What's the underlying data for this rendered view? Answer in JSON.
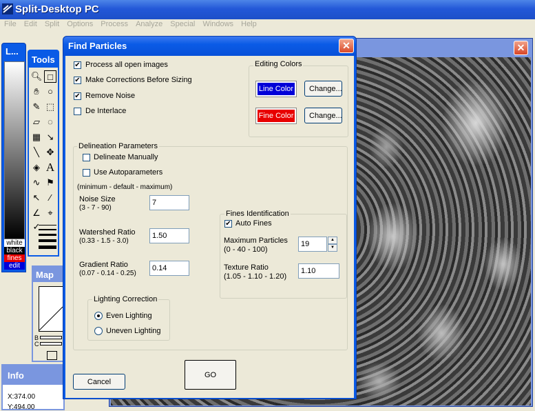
{
  "app": {
    "title": "Split-Desktop PC",
    "menu": [
      "File",
      "Edit",
      "Split",
      "Options",
      "Process",
      "Analyze",
      "Special",
      "Windows",
      "Help"
    ]
  },
  "lut_window": {
    "title": "L...",
    "labels": [
      "white",
      "black",
      "fines",
      "edit"
    ]
  },
  "tools_window": {
    "title": "Tools",
    "text_tool_glyph": "A"
  },
  "map_window": {
    "title": "Map",
    "labels": [
      "B",
      "C"
    ]
  },
  "info_window": {
    "title": "Info",
    "x": "X:374.00",
    "y": "Y:494.00"
  },
  "image_window": {
    "close_glyph": "✕"
  },
  "dialog": {
    "title": "Find Particles",
    "close_glyph": "✕",
    "options": {
      "process_all": {
        "label": "Process all open images",
        "checked": true
      },
      "make_corrections": {
        "label": "Make Corrections Before Sizing",
        "checked": true
      },
      "remove_noise": {
        "label": "Remove Noise",
        "checked": true
      },
      "de_interlace": {
        "label": "De Interlace",
        "checked": false
      }
    },
    "editing_colors": {
      "title": "Editing Colors",
      "line_color_label": "Line Color",
      "line_color": "#0000d8",
      "fine_color_label": "Fine Color",
      "fine_color": "#e80000",
      "change_label": "Change..."
    },
    "delineation": {
      "title": "Delineation Parameters",
      "delineate_manually": {
        "label": "Delineate Manually",
        "checked": false
      },
      "use_autoparameters": {
        "label": "Use Autoparameters",
        "checked": false
      },
      "range_note": "(minimum - default - maximum)",
      "noise_size": {
        "label": "Noise Size",
        "range": "(3 - 7 - 90)",
        "value": "7"
      },
      "watershed_ratio": {
        "label": "Watershed Ratio",
        "range": "(0.33 - 1.5 - 3.0)",
        "value": "1.50"
      },
      "gradient_ratio": {
        "label": "Gradient Ratio",
        "range": "(0.07 - 0.14 - 0.25)",
        "value": "0.14"
      }
    },
    "lighting": {
      "title": "Lighting Correction",
      "even": {
        "label": "Even Lighting",
        "selected": true
      },
      "uneven": {
        "label": "Uneven Lighting",
        "selected": false
      }
    },
    "fines": {
      "title": "Fines Identification",
      "auto_fines": {
        "label": "Auto Fines",
        "checked": true
      },
      "max_particles": {
        "label": "Maximum Particles",
        "range": "(0 - 40 - 100)",
        "value": "19"
      },
      "texture_ratio": {
        "label": "Texture Ratio",
        "range": "(1.05 - 1.10 - 1.20)",
        "value": "1.10"
      }
    },
    "buttons": {
      "cancel": "Cancel",
      "go": "GO"
    }
  }
}
